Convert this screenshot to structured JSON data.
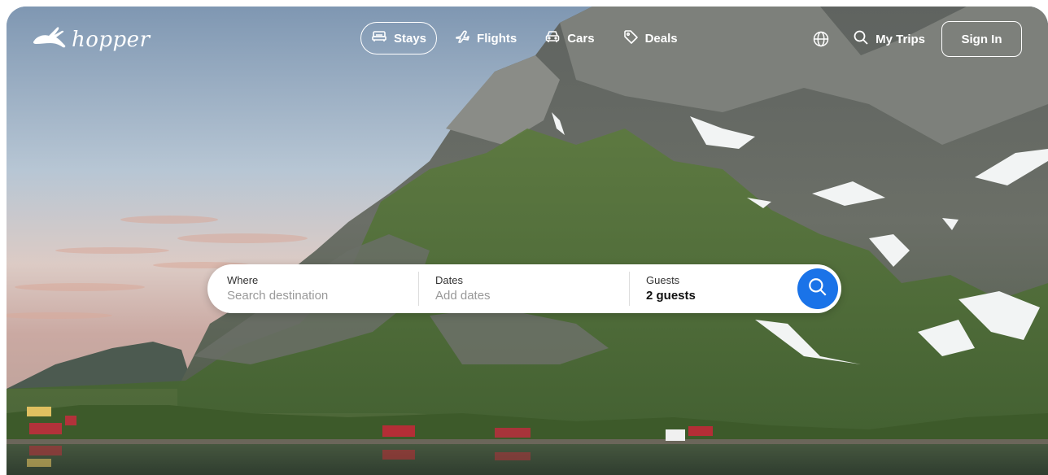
{
  "brand": {
    "name": "hopper",
    "logo_icon": "bunny-icon"
  },
  "nav": {
    "tabs": [
      {
        "label": "Stays",
        "icon": "bed-icon",
        "active": true
      },
      {
        "label": "Flights",
        "icon": "plane-icon",
        "active": false
      },
      {
        "label": "Cars",
        "icon": "car-icon",
        "active": false
      },
      {
        "label": "Deals",
        "icon": "tag-icon",
        "active": false
      }
    ],
    "language_icon": "globe-icon",
    "my_trips": {
      "label": "My Trips",
      "icon": "search-icon"
    },
    "sign_in": "Sign In"
  },
  "search": {
    "where": {
      "label": "Where",
      "placeholder": "Search destination"
    },
    "dates": {
      "label": "Dates",
      "placeholder": "Add dates"
    },
    "guests": {
      "label": "Guests",
      "value": "2 guests"
    },
    "button_icon": "search-icon"
  },
  "colors": {
    "accent": "#1a73e8",
    "nav_text": "#ffffff"
  }
}
